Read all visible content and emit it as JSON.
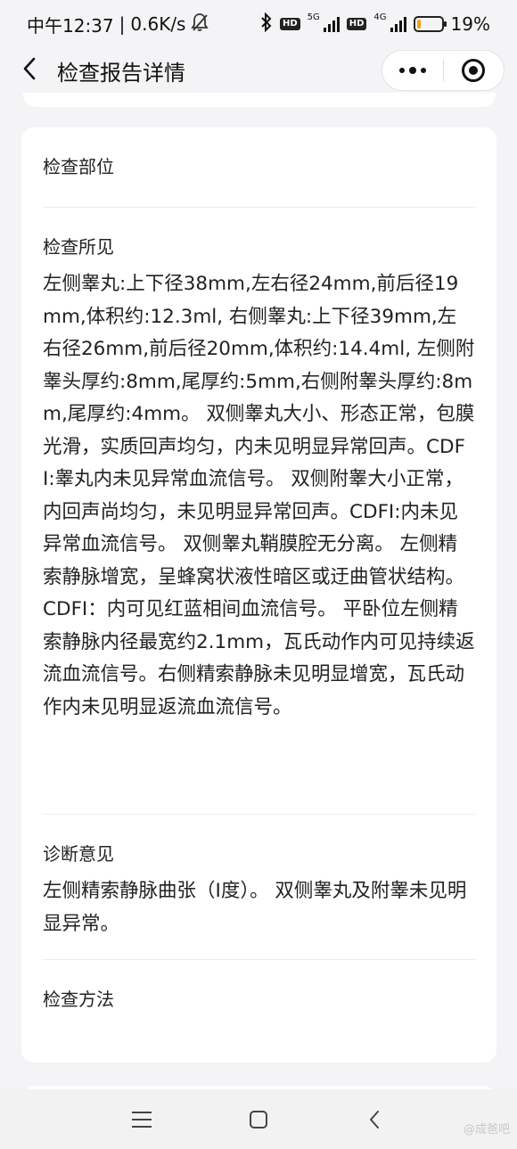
{
  "status_bar": {
    "time": "中午12:37",
    "speed": "0.6K/s",
    "net1": "5G",
    "net2": "4G",
    "hd": "HD",
    "battery_percent": "19%",
    "battery_level": 0.19,
    "battery_color": "#f0a020"
  },
  "nav": {
    "title": "检查报告详情",
    "back_icon": "chevron-left-icon",
    "more_icon": "more-dots-icon",
    "close_icon": "target-icon"
  },
  "report": {
    "sections": [
      {
        "label": "检查部位",
        "body": ""
      },
      {
        "label": "检查所见",
        "body": "左侧睾丸:上下径38mm,左右径24mm,前后径19mm,体积约:12.3ml, 右侧睾丸:上下径39mm,左右径26mm,前后径20mm,体积约:14.4ml, 左侧附睾头厚约:8mm,尾厚约:5mm,右侧附睾头厚约:8mm,尾厚约:4mm。 双侧睾丸大小、形态正常，包膜光滑，实质回声均匀，内未见明显异常回声。CDFI:睾丸内未见异常血流信号。 双侧附睾大小正常，内回声尚均匀，未见明显异常回声。CDFI:内未见异常血流信号。 双侧睾丸鞘膜腔无分离。 左侧精索静脉增宽，呈蜂窝状液性暗区或迂曲管状结构。CDFI：内可见红蓝相间血流信号。 平卧位左侧精索静脉内径最宽约2.1mm，瓦氏动作内可见持续返流血流信号。右侧精索静脉未见明显增宽，瓦氏动作内未见明显返流血流信号。"
      },
      {
        "label": "诊断意见",
        "body": "左侧精索静脉曲张（I度）。 双侧睾丸及附睾未见明显异常。"
      },
      {
        "label": "检查方法",
        "body": ""
      }
    ]
  },
  "system_nav": {
    "menu_icon": "menu-icon",
    "home_icon": "home-icon",
    "back_icon": "back-icon"
  },
  "watermark": "@成爸吧"
}
